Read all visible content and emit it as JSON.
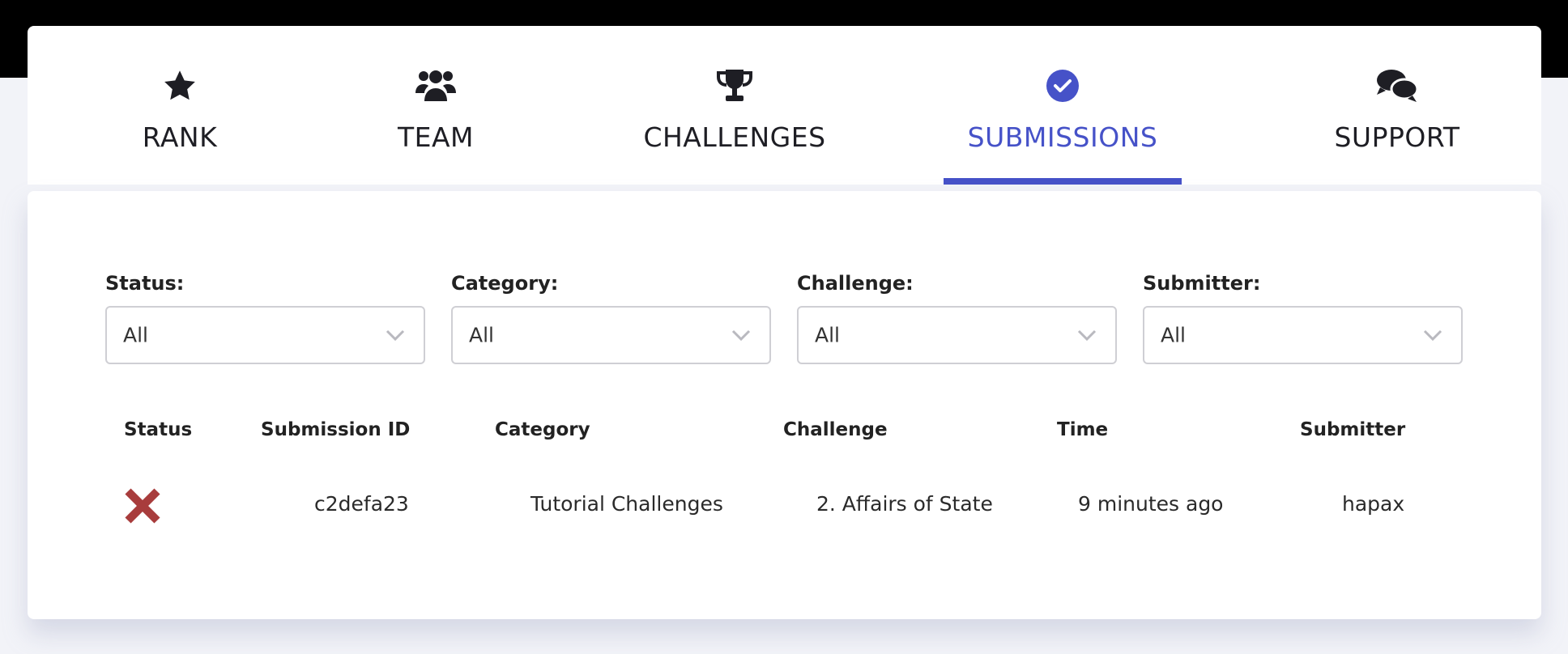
{
  "nav": {
    "tabs": [
      {
        "label": "RANK",
        "icon": "star-icon",
        "active": false
      },
      {
        "label": "TEAM",
        "icon": "users-icon",
        "active": false
      },
      {
        "label": "CHALLENGES",
        "icon": "trophy-icon",
        "active": false
      },
      {
        "label": "SUBMISSIONS",
        "icon": "check-circle-icon",
        "active": true
      },
      {
        "label": "SUPPORT",
        "icon": "comments-icon",
        "active": false
      }
    ],
    "accent_color": "#4652c8"
  },
  "filters": [
    {
      "label": "Status:",
      "value": "All"
    },
    {
      "label": "Category:",
      "value": "All"
    },
    {
      "label": "Challenge:",
      "value": "All"
    },
    {
      "label": "Submitter:",
      "value": "All"
    }
  ],
  "table": {
    "headers": [
      "Status",
      "Submission ID",
      "Category",
      "Challenge",
      "Time",
      "Submitter"
    ],
    "rows": [
      {
        "status": "incorrect",
        "status_icon": "x-icon",
        "status_color": "#a83c3c",
        "submission_id": "c2defa23",
        "category": "Tutorial Challenges",
        "challenge": "2. Affairs of State",
        "time": "9 minutes ago",
        "submitter": "hapax"
      }
    ]
  }
}
